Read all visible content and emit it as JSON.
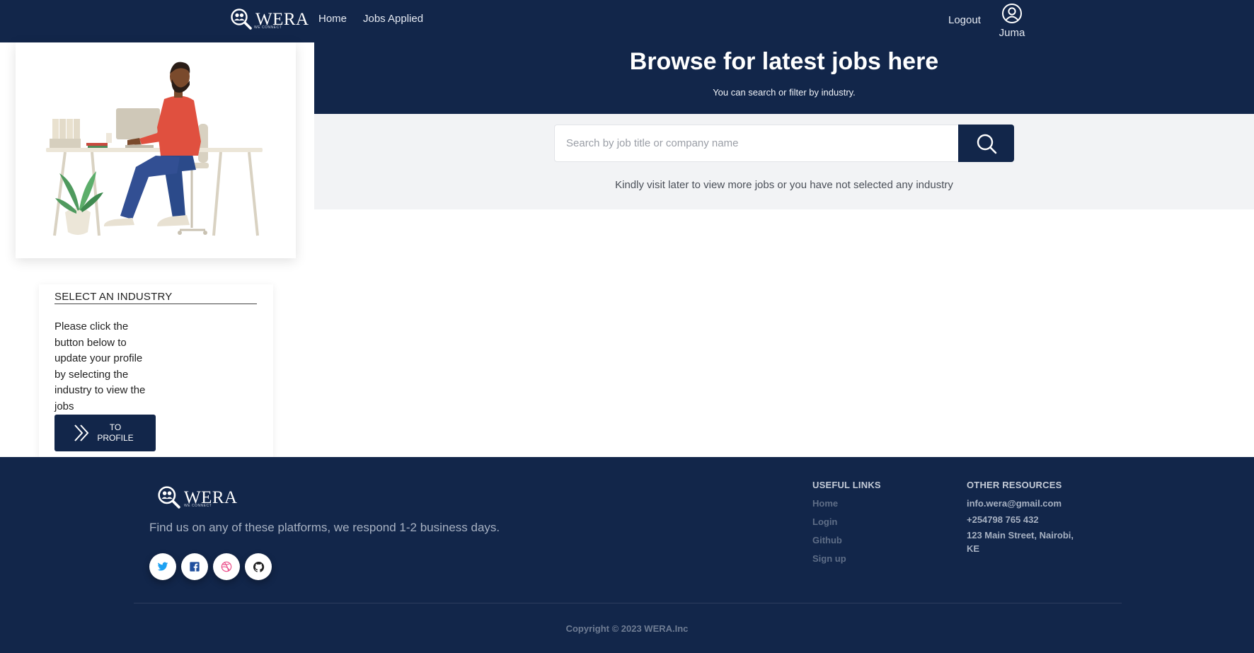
{
  "nav": {
    "brand": "WERA",
    "brand_sub": "WE CONNECT",
    "home": "Home",
    "jobs_applied": "Jobs Applied",
    "logout": "Logout",
    "username": "Juma"
  },
  "hero": {
    "title": "Browse for latest jobs here",
    "subtitle": "You can search or filter by industry."
  },
  "search": {
    "placeholder": "Search by job title or company name",
    "value": "",
    "notice": "Kindly visit later to view more jobs or you have not selected any industry"
  },
  "industry": {
    "title": "SELECT AN INDUSTRY",
    "text": "Please click the button below to update your profile by selecting the industry to view the jobs",
    "button": "TO PROFILE"
  },
  "footer": {
    "brand": "WERA",
    "brand_sub": "WE CONNECT",
    "tagline": "Find us on any of these platforms, we respond 1-2 business days.",
    "useful_links_title": "USEFUL LINKS",
    "useful_links": [
      "Home",
      "Login",
      "Github",
      "Sign up"
    ],
    "other_title": "OTHER RESOURCES",
    "email": "info.wera@gmail.com",
    "phone": "+254798 765 432",
    "address": "123 Main Street, Nairobi, KE",
    "copyright": "Copyright © 2023 WERA.Inc",
    "socials": [
      "twitter-icon",
      "facebook-icon",
      "dribbble-icon",
      "github-icon"
    ]
  },
  "colors": {
    "primary": "#12264a",
    "band": "#f2f3f5",
    "twitter": "#1da1f2",
    "facebook": "#1877f2",
    "dribbble": "#ea4c89"
  }
}
